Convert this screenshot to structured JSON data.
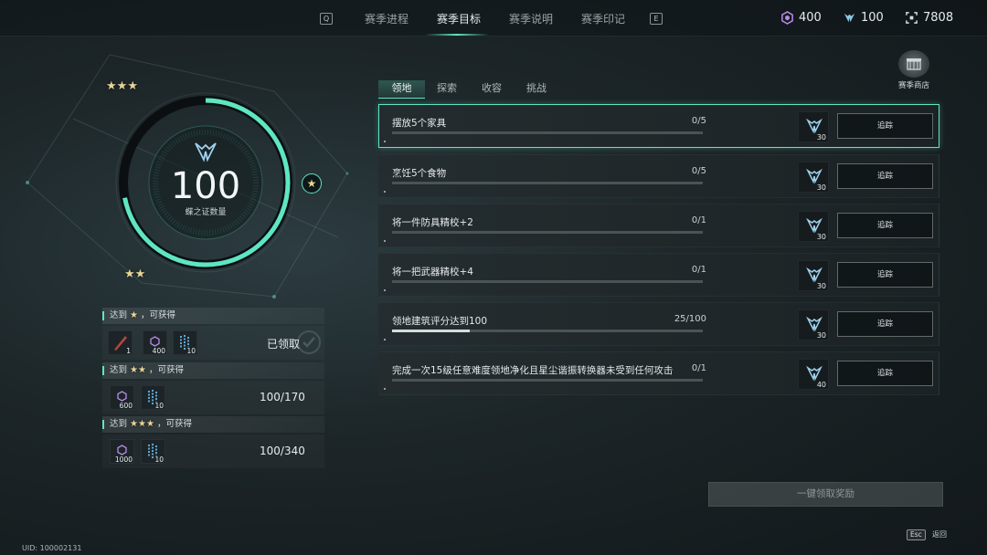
{
  "topbar": {
    "left_key": "Q",
    "right_key": "E",
    "tabs": [
      {
        "label": "赛季进程"
      },
      {
        "label": "赛季目标"
      },
      {
        "label": "赛季说明"
      },
      {
        "label": "赛季印记"
      }
    ],
    "active_tab": "赛季目标",
    "currencies": [
      {
        "icon": "purple-hexagon-currency-icon",
        "value": "400",
        "color": "#b98ae6"
      },
      {
        "icon": "butterfly-token-icon",
        "value": "100",
        "color": "#8fc9e6"
      },
      {
        "icon": "fragment-currency-icon",
        "value": "7808",
        "color": "#d8dee2"
      }
    ]
  },
  "progress_ring": {
    "count": "100",
    "caption": "蝶之证数量",
    "fill_fraction": 0.72,
    "accent_color": "#5ee6c2"
  },
  "tiers": [
    {
      "header_prefix": "达到",
      "stars": "★",
      "header_suffix": "，可获得",
      "rewards": [
        {
          "icon": "red-feather-item-icon",
          "qty": "1"
        },
        {
          "icon": "purple-hexagon-currency-icon",
          "qty": "400"
        },
        {
          "icon": "blue-crystal-item-icon",
          "qty": "10"
        }
      ],
      "status": "已领取"
    },
    {
      "header_prefix": "达到",
      "stars": "★★",
      "header_suffix": "，可获得",
      "rewards": [
        {
          "icon": "purple-hexagon-currency-icon",
          "qty": "600"
        },
        {
          "icon": "blue-crystal-item-icon",
          "qty": "10"
        }
      ],
      "status": "100/170"
    },
    {
      "header_prefix": "达到",
      "stars": "★★★",
      "header_suffix": "，可获得",
      "rewards": [
        {
          "icon": "purple-hexagon-currency-icon",
          "qty": "1000"
        },
        {
          "icon": "blue-crystal-item-icon",
          "qty": "10"
        }
      ],
      "status": "100/340"
    }
  ],
  "sub_tabs": [
    {
      "label": "领地"
    },
    {
      "label": "探索"
    },
    {
      "label": "收容"
    },
    {
      "label": "挑战"
    }
  ],
  "active_sub_tab": "领地",
  "tasks": [
    {
      "title": "摆放5个家具",
      "progress": "0/5",
      "fraction": 0,
      "reward_qty": "30",
      "button": "追踪"
    },
    {
      "title": "烹饪5个食物",
      "progress": "0/5",
      "fraction": 0,
      "reward_qty": "30",
      "button": "追踪"
    },
    {
      "title": "将一件防具精校+2",
      "progress": "0/1",
      "fraction": 0,
      "reward_qty": "30",
      "button": "追踪"
    },
    {
      "title": "将一把武器精校+4",
      "progress": "0/1",
      "fraction": 0,
      "reward_qty": "30",
      "button": "追踪"
    },
    {
      "title": "领地建筑评分达到100",
      "progress": "25/100",
      "fraction": 0.25,
      "reward_qty": "30",
      "button": "追踪"
    },
    {
      "title": "完成一次15级任意难度领地净化且星尘谐振转换器未受到任何攻击",
      "progress": "0/1",
      "fraction": 0,
      "reward_qty": "40",
      "button": "追踪"
    }
  ],
  "claim_all_label": "一键领取奖励",
  "shop_label": "赛季商店",
  "back": {
    "key": "Esc",
    "label": "返回"
  },
  "uid": "UID: 100002131"
}
